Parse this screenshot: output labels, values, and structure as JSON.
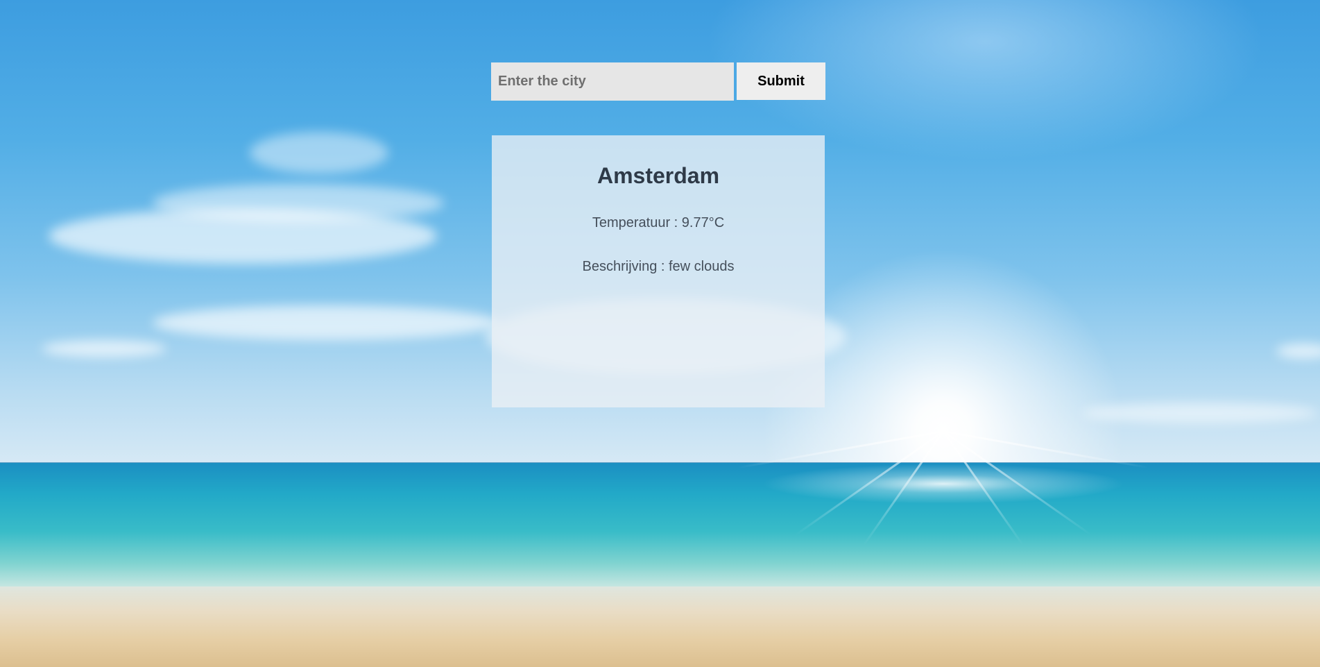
{
  "search": {
    "placeholder": "Enter the city",
    "value": "",
    "submit_label": "Submit"
  },
  "weather": {
    "city": "Amsterdam",
    "temperature_label": "Temperatuur",
    "temperature_value": "9.77°C",
    "description_label": "Beschrijving",
    "description_value": "few clouds",
    "temperature_text": "Temperatuur : 9.77°C",
    "description_text": "Beschrijving : few clouds"
  },
  "background": {
    "scene": "beach-sunny-sky",
    "colors": {
      "sky": "#52aee6",
      "sea": "#22a9c8",
      "sand": "#e6cfa6"
    }
  }
}
